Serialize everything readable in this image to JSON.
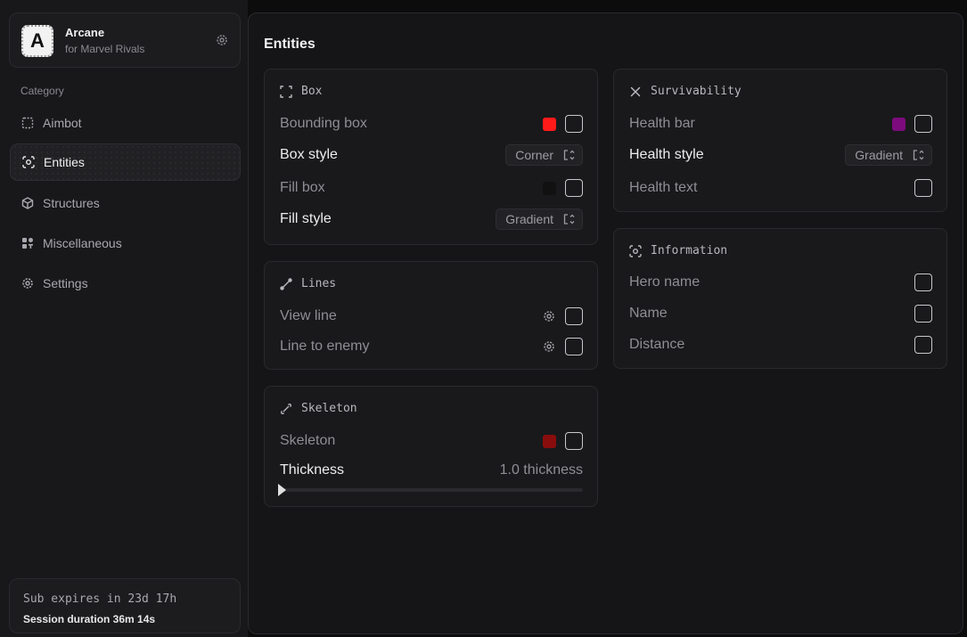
{
  "brand": {
    "logo_letter": "A",
    "name": "Arcane",
    "subtitle": "for Marvel Rivals",
    "settings_icon": "gear-icon"
  },
  "sidebar": {
    "category_label": "Category",
    "items": [
      {
        "label": "Aimbot",
        "icon": "crosshair-dotted-icon",
        "active": false
      },
      {
        "label": "Entities",
        "icon": "scan-face-icon",
        "active": true
      },
      {
        "label": "Structures",
        "icon": "cube-icon",
        "active": false
      },
      {
        "label": "Miscellaneous",
        "icon": "grid-hash-icon",
        "active": false
      },
      {
        "label": "Settings",
        "icon": "gear-icon",
        "active": false
      }
    ]
  },
  "footer": {
    "subscription": "Sub expires in 23d 17h",
    "session": "Session duration 36m 14s"
  },
  "main": {
    "title": "Entities",
    "box": {
      "title": "Box",
      "bounding_box": {
        "label": "Bounding box",
        "color": "#ff1a1a",
        "checked": false
      },
      "box_style": {
        "label": "Box style",
        "value": "Corner"
      },
      "fill_box": {
        "label": "Fill box",
        "color": "#111111",
        "checked": false
      },
      "fill_style": {
        "label": "Fill style",
        "value": "Gradient"
      }
    },
    "lines": {
      "title": "Lines",
      "view_line": {
        "label": "View line",
        "checked": false
      },
      "line_to_enemy": {
        "label": "Line to enemy",
        "checked": false
      }
    },
    "skeleton": {
      "title": "Skeleton",
      "skeleton": {
        "label": "Skeleton",
        "color": "#8a0d0d",
        "checked": false
      },
      "thickness": {
        "label": "Thickness",
        "value": "1.0 thickness",
        "fraction": 0.0
      }
    },
    "survivability": {
      "title": "Survivability",
      "health_bar": {
        "label": "Health bar",
        "color": "#7d0b7d",
        "checked": false
      },
      "health_style": {
        "label": "Health style",
        "value": "Gradient"
      },
      "health_text": {
        "label": "Health text",
        "checked": false
      }
    },
    "information": {
      "title": "Information",
      "hero_name": {
        "label": "Hero name",
        "checked": false
      },
      "name": {
        "label": "Name",
        "checked": false
      },
      "distance": {
        "label": "Distance",
        "checked": false
      }
    }
  }
}
